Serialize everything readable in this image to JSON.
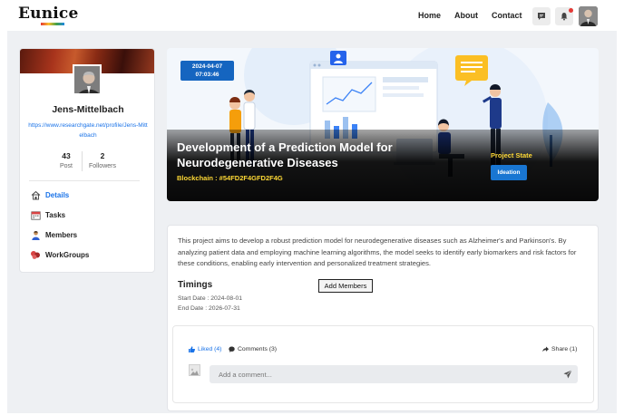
{
  "brand": {
    "logo_text": "Eunice"
  },
  "nav": {
    "home": "Home",
    "about": "About",
    "contact": "Contact"
  },
  "colors": {
    "accent": "#1a73e8",
    "highlight": "#fdd835",
    "state_button": "#1976d2",
    "date_badge": "#1565c0"
  },
  "profile": {
    "name": "Jens-Mittelbach",
    "link": "https://www.researchgate.net/profile/Jens-Mittelbach",
    "posts_count": "43",
    "posts_label": "Post",
    "followers_count": "2",
    "followers_label": "Followers"
  },
  "sidebar": {
    "items": [
      {
        "label": "Details",
        "icon": "home-icon",
        "active": true
      },
      {
        "label": "Tasks",
        "icon": "calendar-icon",
        "active": false
      },
      {
        "label": "Members",
        "icon": "user-icon",
        "active": false
      },
      {
        "label": "WorkGroups",
        "icon": "group-icon",
        "active": false
      }
    ]
  },
  "project": {
    "date": "2024-04-07",
    "time": "07:03:46",
    "title": "Development of a Prediction Model for Neurodegenerative Diseases",
    "blockchain": "Blockchain : #54FD2F4GFD2F4G",
    "state_label": "Project State",
    "state_value": "Ideation",
    "description": "This project aims to develop a robust prediction model for neurodegenerative diseases such as Alzheimer's and Parkinson's. By analyzing patient data and employing machine learning algorithms, the model seeks to identify early biomarkers and risk factors for these conditions, enabling early intervention and personalized treatment strategies.",
    "timings_title": "Timings",
    "start_date": "Start Date : 2024-08-01",
    "end_date": "End Date : 2026-07-31",
    "add_members_label": "Add Members"
  },
  "comments": {
    "liked_label": "Liked (4)",
    "comments_label": "Comments (3)",
    "share_label": "Share (1)",
    "placeholder": "Add a comment..."
  }
}
